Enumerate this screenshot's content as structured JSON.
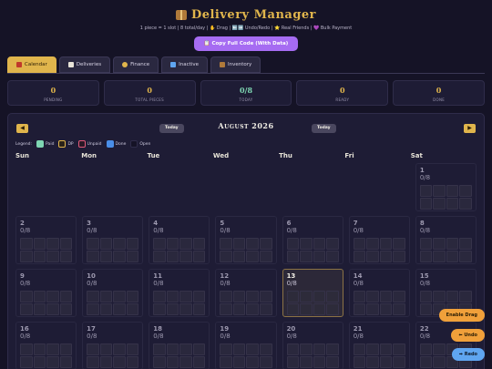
{
  "app": {
    "title": "Delivery Manager",
    "subtitle": "1 piece = 1 slot | 8 total/day | ✋ Drag | ⬅️➡️ Undo/Redo | ⭐ Real Friends | 💜 Bulk Payment",
    "copy_button": "Copy Full Code (With Data)"
  },
  "tabs": [
    {
      "label": "Calendar",
      "icon": "calendar-icon",
      "active": true
    },
    {
      "label": "Deliveries",
      "icon": "clipboard-icon"
    },
    {
      "label": "Finance",
      "icon": "money-bag-icon"
    },
    {
      "label": "Inactive",
      "icon": "sleep-icon"
    },
    {
      "label": "Inventory",
      "icon": "box-icon"
    }
  ],
  "stats": [
    {
      "value": "0",
      "label": "PENDING"
    },
    {
      "value": "0",
      "label": "TOTAL PIECES"
    },
    {
      "value": "0/8",
      "label": "TODAY"
    },
    {
      "value": "0",
      "label": "READY"
    },
    {
      "value": "0",
      "label": "DONE"
    }
  ],
  "calendar": {
    "month": "August 2026",
    "prev": "◀",
    "next": "▶",
    "today_label": "Today",
    "legend_title": "Legend:",
    "legend": [
      {
        "label": "Paid",
        "color": "#7ed6b2"
      },
      {
        "label": "DP",
        "color": "#e0b54c"
      },
      {
        "label": "Unpaid",
        "color": "#e05a7a"
      },
      {
        "label": "Done",
        "color": "#4a8ee8"
      },
      {
        "label": "Open",
        "color": "#151326"
      }
    ],
    "weekdays": [
      "Sun",
      "Mon",
      "Tue",
      "Wed",
      "Thu",
      "Fri",
      "Sat"
    ],
    "days": [
      {
        "n": "",
        "c": ""
      },
      {
        "n": "",
        "c": ""
      },
      {
        "n": "",
        "c": ""
      },
      {
        "n": "",
        "c": ""
      },
      {
        "n": "",
        "c": ""
      },
      {
        "n": "",
        "c": ""
      },
      {
        "n": "1",
        "c": "0/8"
      },
      {
        "n": "2",
        "c": "0/8"
      },
      {
        "n": "3",
        "c": "0/8"
      },
      {
        "n": "4",
        "c": "0/8"
      },
      {
        "n": "5",
        "c": "0/8"
      },
      {
        "n": "6",
        "c": "0/8"
      },
      {
        "n": "7",
        "c": "0/8"
      },
      {
        "n": "8",
        "c": "0/8"
      },
      {
        "n": "9",
        "c": "0/8"
      },
      {
        "n": "10",
        "c": "0/8"
      },
      {
        "n": "11",
        "c": "0/8"
      },
      {
        "n": "12",
        "c": "0/8"
      },
      {
        "n": "13",
        "c": "0/8",
        "today": true
      },
      {
        "n": "14",
        "c": "0/8"
      },
      {
        "n": "15",
        "c": "0/8"
      },
      {
        "n": "16",
        "c": "0/8"
      },
      {
        "n": "17",
        "c": "0/8"
      },
      {
        "n": "18",
        "c": "0/8"
      },
      {
        "n": "19",
        "c": "0/8"
      },
      {
        "n": "20",
        "c": "0/8"
      },
      {
        "n": "21",
        "c": "0/8"
      },
      {
        "n": "22",
        "c": "0/8"
      }
    ]
  },
  "floating": {
    "drag": "Enable Drag",
    "undo": "Undo",
    "redo": "Redo"
  },
  "colors": {
    "accent": "#e0b54c",
    "purple": "#a66cf2",
    "background": "#151326"
  }
}
